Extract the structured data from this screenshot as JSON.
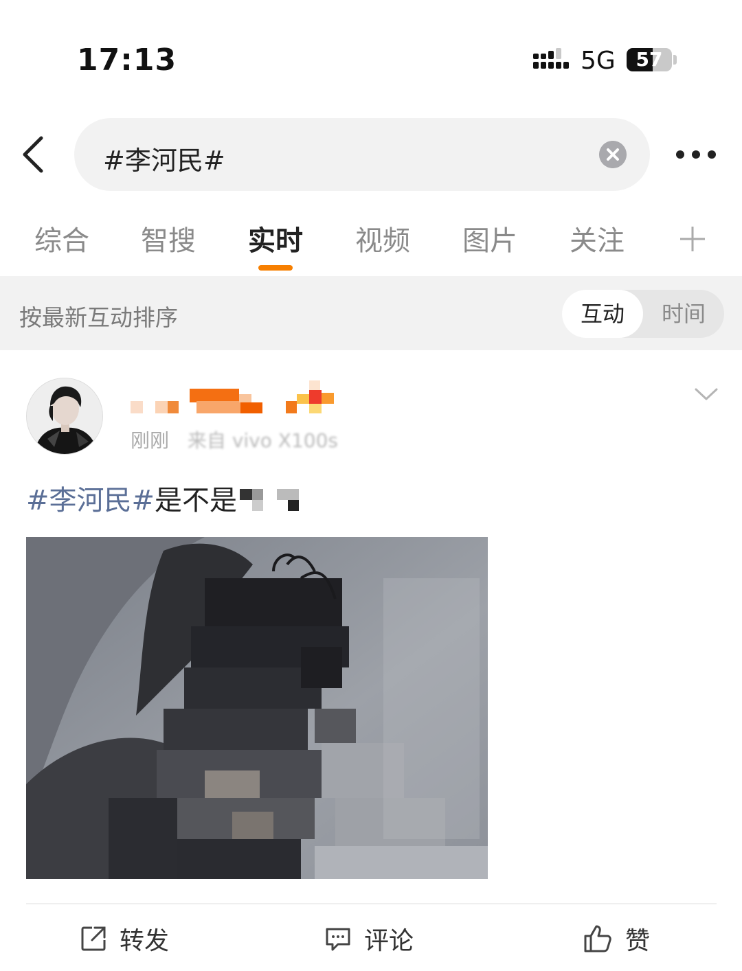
{
  "status_bar": {
    "time": "17:13",
    "network": "5G",
    "battery_level": "57"
  },
  "search": {
    "query": "#李河民#"
  },
  "tabs": [
    {
      "label": "综合",
      "active": false
    },
    {
      "label": "智搜",
      "active": false
    },
    {
      "label": "实时",
      "active": true
    },
    {
      "label": "视频",
      "active": false
    },
    {
      "label": "图片",
      "active": false
    },
    {
      "label": "关注",
      "active": false
    }
  ],
  "sort": {
    "label": "按最新互动排序",
    "options": [
      "互动",
      "时间"
    ],
    "selected": "互动"
  },
  "post": {
    "meta_time": "刚刚",
    "meta_source": "来自 vivo X100s",
    "hashtag": "#李河民#",
    "text": "是不是",
    "actions": {
      "repost": "转发",
      "comment": "评论",
      "like": "赞"
    }
  },
  "colors": {
    "accent": "#f77f00",
    "hashtag": "#5b6f97",
    "background_gray": "#f2f2f2"
  }
}
